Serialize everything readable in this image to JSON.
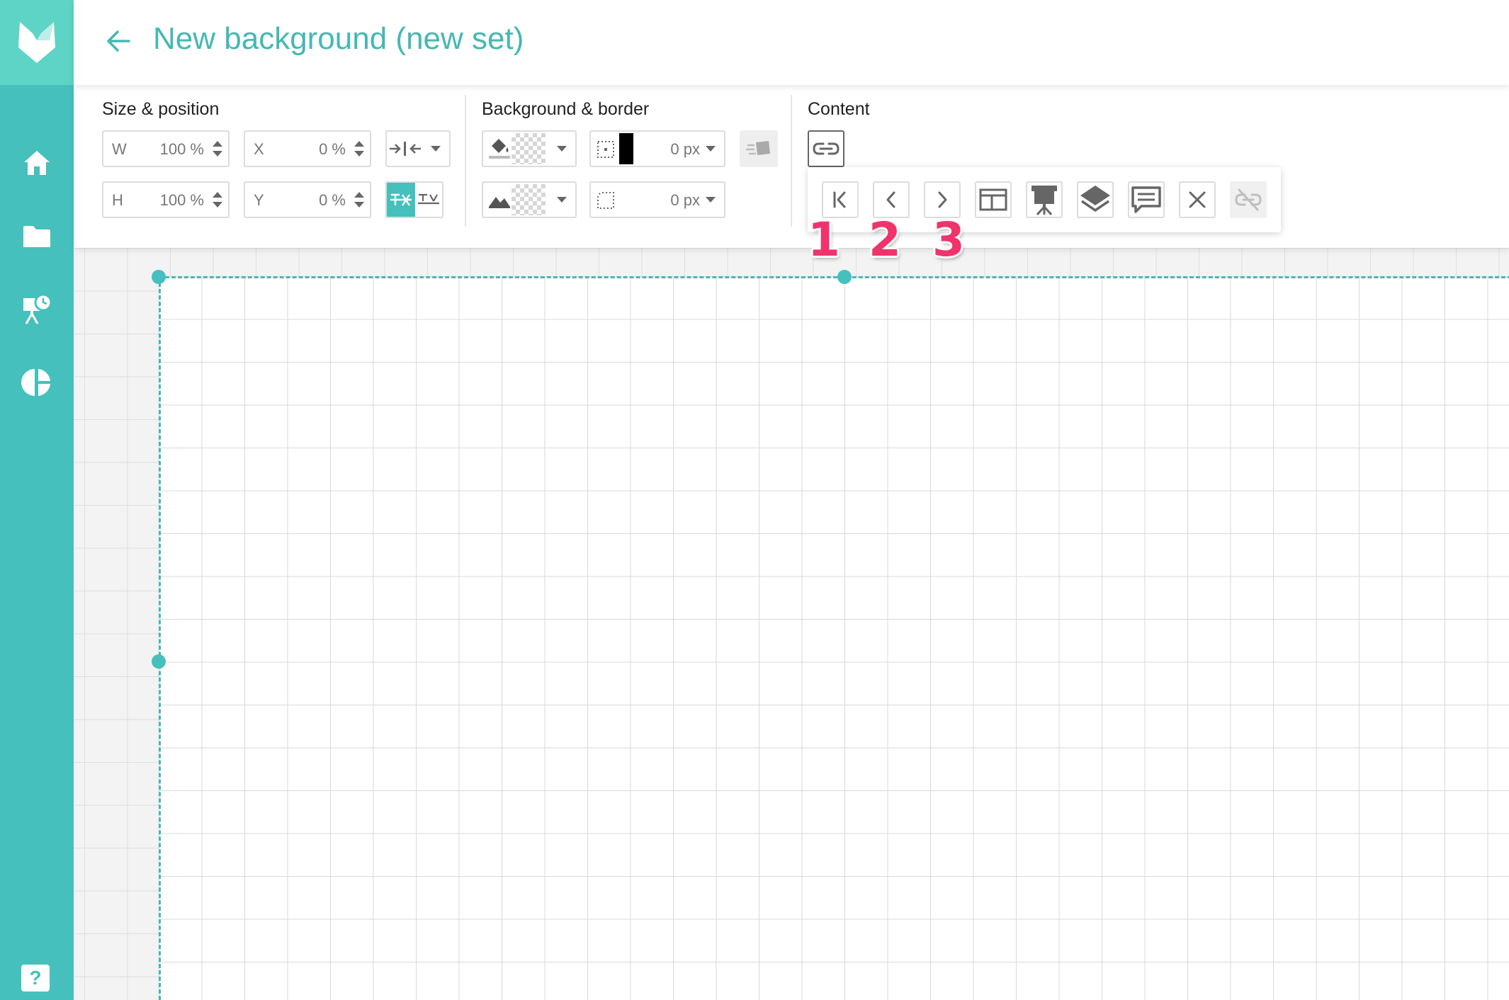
{
  "header": {
    "title": "New background (new set)"
  },
  "sidebar": {
    "items": [
      {
        "name": "home",
        "icon": "home-icon"
      },
      {
        "name": "folder",
        "icon": "folder-icon"
      },
      {
        "name": "presentation",
        "icon": "presentation-clock-icon"
      },
      {
        "name": "stats",
        "icon": "pie-chart-icon"
      }
    ],
    "help_label": "?"
  },
  "toolbar": {
    "size_position": {
      "title": "Size & position",
      "w_label": "W",
      "w_value": "100 %",
      "h_label": "H",
      "h_value": "100 %",
      "x_label": "X",
      "x_value": "0 %",
      "y_label": "Y",
      "y_value": "0 %"
    },
    "background_border": {
      "title": "Background & border",
      "border_width": "0 px",
      "radius_value": "0 px"
    },
    "content": {
      "title": "Content"
    }
  },
  "content_panel": {
    "buttons": [
      {
        "name": "first",
        "icon": "first-page-icon"
      },
      {
        "name": "prev",
        "icon": "chevron-left-icon"
      },
      {
        "name": "next",
        "icon": "chevron-right-icon"
      },
      {
        "name": "layout",
        "icon": "layout-icon"
      },
      {
        "name": "presentation",
        "icon": "presentation-icon"
      },
      {
        "name": "layers",
        "icon": "layers-icon"
      },
      {
        "name": "comment",
        "icon": "comment-icon"
      },
      {
        "name": "close",
        "icon": "close-icon"
      },
      {
        "name": "unlink",
        "icon": "unlink-icon",
        "disabled": true
      }
    ]
  },
  "annotations": [
    "1",
    "2",
    "3"
  ],
  "colors": {
    "accent": "#45c0bc",
    "title": "#45b8b3",
    "annotation": "#f0336c"
  }
}
